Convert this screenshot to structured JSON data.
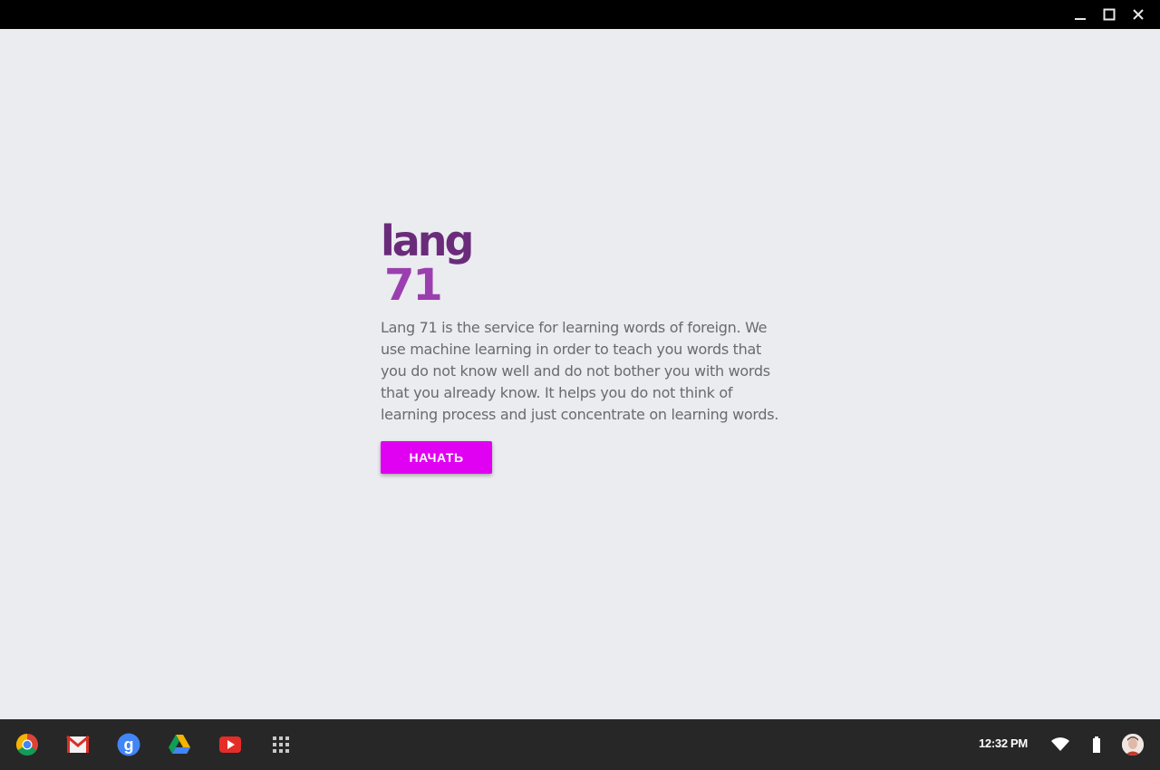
{
  "window": {
    "controls": [
      "minimize",
      "maximize",
      "close"
    ]
  },
  "app": {
    "logo": {
      "line1": "lang",
      "line2": "71",
      "color_dark": "#6a2c7a",
      "color_light": "#9b3fb0"
    },
    "description": "Lang 71 is the service for learning words of foreign. We use machine learning in order to teach you words that you do not know well and do not bother you with words that you already know. It helps you do not think of learning process and just concentrate on learning words.",
    "start_button_label": "НАЧАТЬ",
    "accent_color": "#e000f2"
  },
  "shelf": {
    "apps": [
      "chrome-icon",
      "gmail-icon",
      "google-search-icon",
      "drive-icon",
      "youtube-icon",
      "app-launcher-icon"
    ],
    "clock": "12:32 PM",
    "tray": [
      "wifi-icon",
      "battery-icon",
      "avatar"
    ]
  }
}
